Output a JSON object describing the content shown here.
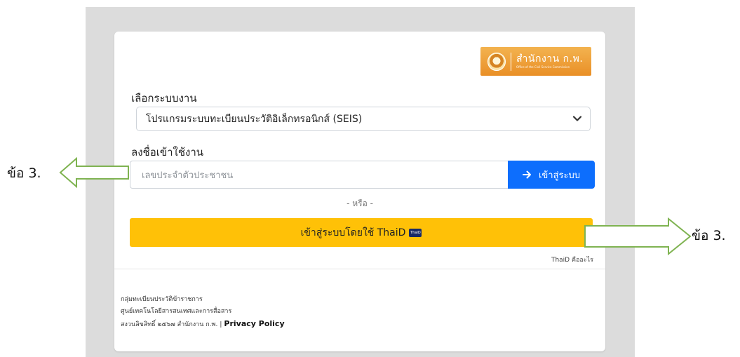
{
  "logo": {
    "text": "สำนักงาน ก.พ.",
    "subtext": "Office of the Civil Service Commission"
  },
  "system_select": {
    "label": "เลือกระบบงาน",
    "value": "โปรแกรมระบบทะเบียนประวัติอิเล็กทรอนิกส์ (SEIS)"
  },
  "login": {
    "label": "ลงชื่อเข้าใช้งาน",
    "id_placeholder": "เลขประจำตัวประชาชน",
    "button_label": "เข้าสู่ระบบ"
  },
  "or_text": "- หรือ -",
  "thaid": {
    "button_label": "เข้าสู่ระบบโดยใช้ ThaiD",
    "badge_text": "ThaiD",
    "help_link": "ThaiD คืออะไร"
  },
  "footer": {
    "line1": "กลุ่มทะเบียนประวัติข้าราชการ",
    "line2": "ศูนย์เทคโนโลยีสารสนเทศและการสื่อสาร",
    "line3": "สงวนลิขสิทธิ์ ๒๕๖๗ สำนักงาน ก.พ.",
    "separator": "|",
    "privacy": "Privacy Policy"
  },
  "annotations": {
    "left": "ข้อ 3.",
    "right": "ข้อ 3."
  },
  "colors": {
    "primary": "#0d6efd",
    "thaid_yellow": "#ffc107",
    "logo_orange": "#ef9f35",
    "arrow_green": "#7fb351"
  }
}
